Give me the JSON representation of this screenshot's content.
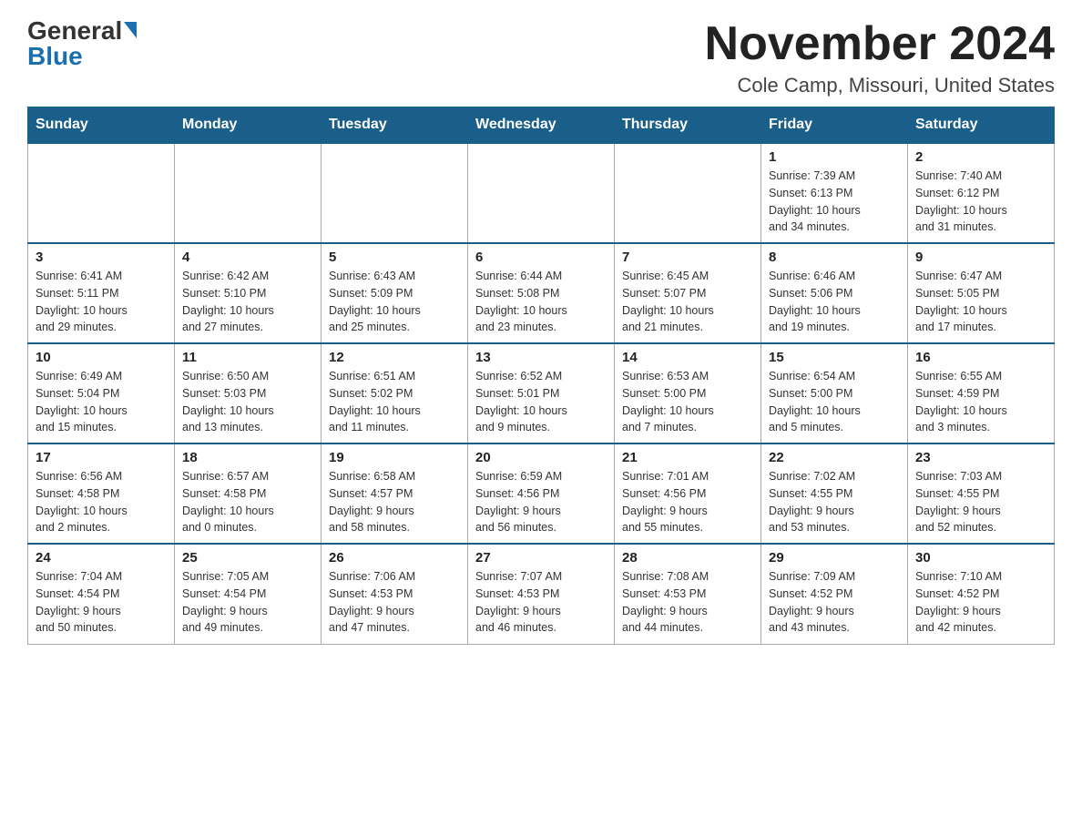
{
  "header": {
    "logo_general": "General",
    "logo_blue": "Blue",
    "month_title": "November 2024",
    "location": "Cole Camp, Missouri, United States"
  },
  "weekdays": [
    "Sunday",
    "Monday",
    "Tuesday",
    "Wednesday",
    "Thursday",
    "Friday",
    "Saturday"
  ],
  "weeks": [
    [
      {
        "day": "",
        "info": ""
      },
      {
        "day": "",
        "info": ""
      },
      {
        "day": "",
        "info": ""
      },
      {
        "day": "",
        "info": ""
      },
      {
        "day": "",
        "info": ""
      },
      {
        "day": "1",
        "info": "Sunrise: 7:39 AM\nSunset: 6:13 PM\nDaylight: 10 hours\nand 34 minutes."
      },
      {
        "day": "2",
        "info": "Sunrise: 7:40 AM\nSunset: 6:12 PM\nDaylight: 10 hours\nand 31 minutes."
      }
    ],
    [
      {
        "day": "3",
        "info": "Sunrise: 6:41 AM\nSunset: 5:11 PM\nDaylight: 10 hours\nand 29 minutes."
      },
      {
        "day": "4",
        "info": "Sunrise: 6:42 AM\nSunset: 5:10 PM\nDaylight: 10 hours\nand 27 minutes."
      },
      {
        "day": "5",
        "info": "Sunrise: 6:43 AM\nSunset: 5:09 PM\nDaylight: 10 hours\nand 25 minutes."
      },
      {
        "day": "6",
        "info": "Sunrise: 6:44 AM\nSunset: 5:08 PM\nDaylight: 10 hours\nand 23 minutes."
      },
      {
        "day": "7",
        "info": "Sunrise: 6:45 AM\nSunset: 5:07 PM\nDaylight: 10 hours\nand 21 minutes."
      },
      {
        "day": "8",
        "info": "Sunrise: 6:46 AM\nSunset: 5:06 PM\nDaylight: 10 hours\nand 19 minutes."
      },
      {
        "day": "9",
        "info": "Sunrise: 6:47 AM\nSunset: 5:05 PM\nDaylight: 10 hours\nand 17 minutes."
      }
    ],
    [
      {
        "day": "10",
        "info": "Sunrise: 6:49 AM\nSunset: 5:04 PM\nDaylight: 10 hours\nand 15 minutes."
      },
      {
        "day": "11",
        "info": "Sunrise: 6:50 AM\nSunset: 5:03 PM\nDaylight: 10 hours\nand 13 minutes."
      },
      {
        "day": "12",
        "info": "Sunrise: 6:51 AM\nSunset: 5:02 PM\nDaylight: 10 hours\nand 11 minutes."
      },
      {
        "day": "13",
        "info": "Sunrise: 6:52 AM\nSunset: 5:01 PM\nDaylight: 10 hours\nand 9 minutes."
      },
      {
        "day": "14",
        "info": "Sunrise: 6:53 AM\nSunset: 5:00 PM\nDaylight: 10 hours\nand 7 minutes."
      },
      {
        "day": "15",
        "info": "Sunrise: 6:54 AM\nSunset: 5:00 PM\nDaylight: 10 hours\nand 5 minutes."
      },
      {
        "day": "16",
        "info": "Sunrise: 6:55 AM\nSunset: 4:59 PM\nDaylight: 10 hours\nand 3 minutes."
      }
    ],
    [
      {
        "day": "17",
        "info": "Sunrise: 6:56 AM\nSunset: 4:58 PM\nDaylight: 10 hours\nand 2 minutes."
      },
      {
        "day": "18",
        "info": "Sunrise: 6:57 AM\nSunset: 4:58 PM\nDaylight: 10 hours\nand 0 minutes."
      },
      {
        "day": "19",
        "info": "Sunrise: 6:58 AM\nSunset: 4:57 PM\nDaylight: 9 hours\nand 58 minutes."
      },
      {
        "day": "20",
        "info": "Sunrise: 6:59 AM\nSunset: 4:56 PM\nDaylight: 9 hours\nand 56 minutes."
      },
      {
        "day": "21",
        "info": "Sunrise: 7:01 AM\nSunset: 4:56 PM\nDaylight: 9 hours\nand 55 minutes."
      },
      {
        "day": "22",
        "info": "Sunrise: 7:02 AM\nSunset: 4:55 PM\nDaylight: 9 hours\nand 53 minutes."
      },
      {
        "day": "23",
        "info": "Sunrise: 7:03 AM\nSunset: 4:55 PM\nDaylight: 9 hours\nand 52 minutes."
      }
    ],
    [
      {
        "day": "24",
        "info": "Sunrise: 7:04 AM\nSunset: 4:54 PM\nDaylight: 9 hours\nand 50 minutes."
      },
      {
        "day": "25",
        "info": "Sunrise: 7:05 AM\nSunset: 4:54 PM\nDaylight: 9 hours\nand 49 minutes."
      },
      {
        "day": "26",
        "info": "Sunrise: 7:06 AM\nSunset: 4:53 PM\nDaylight: 9 hours\nand 47 minutes."
      },
      {
        "day": "27",
        "info": "Sunrise: 7:07 AM\nSunset: 4:53 PM\nDaylight: 9 hours\nand 46 minutes."
      },
      {
        "day": "28",
        "info": "Sunrise: 7:08 AM\nSunset: 4:53 PM\nDaylight: 9 hours\nand 44 minutes."
      },
      {
        "day": "29",
        "info": "Sunrise: 7:09 AM\nSunset: 4:52 PM\nDaylight: 9 hours\nand 43 minutes."
      },
      {
        "day": "30",
        "info": "Sunrise: 7:10 AM\nSunset: 4:52 PM\nDaylight: 9 hours\nand 42 minutes."
      }
    ]
  ]
}
